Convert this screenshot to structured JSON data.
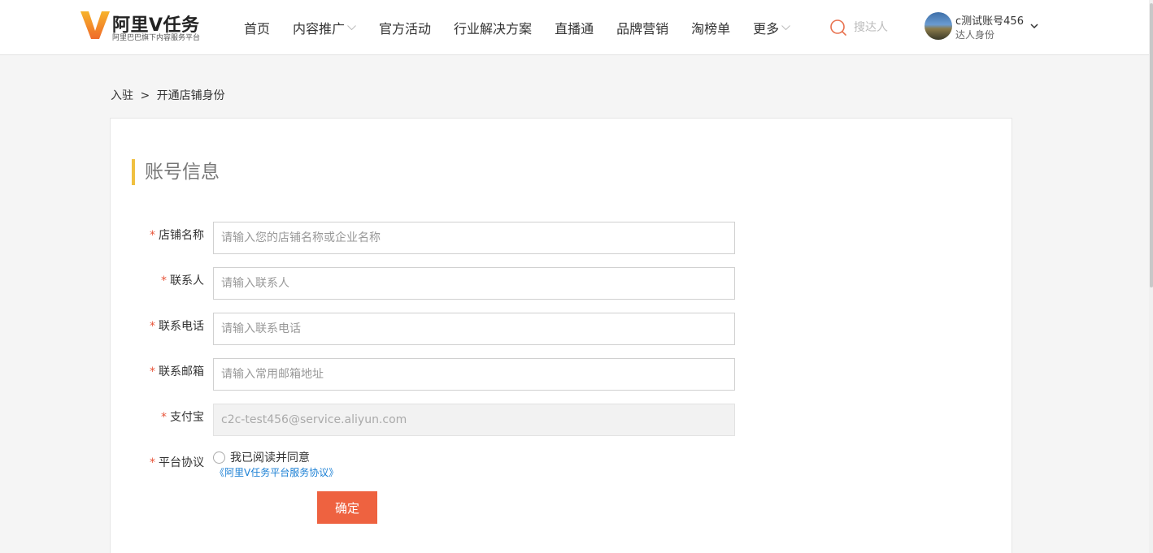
{
  "logo": {
    "mark": "V",
    "title": "阿里V任务",
    "subtitle": "阿里巴巴旗下内容服务平台"
  },
  "nav": {
    "items": [
      {
        "label": "首页",
        "dropdown": false
      },
      {
        "label": "内容推广",
        "dropdown": true
      },
      {
        "label": "官方活动",
        "dropdown": false
      },
      {
        "label": "行业解决方案",
        "dropdown": false
      },
      {
        "label": "直播通",
        "dropdown": false
      },
      {
        "label": "品牌营销",
        "dropdown": false
      },
      {
        "label": "淘榜单",
        "dropdown": false
      },
      {
        "label": "更多",
        "dropdown": true
      }
    ]
  },
  "search": {
    "placeholder": "搜达人"
  },
  "user": {
    "name": "c测试账号456",
    "role": "达人身份"
  },
  "breadcrumb": {
    "parent": "入驻",
    "separator": ">",
    "current": "开通店铺身份"
  },
  "form": {
    "section_title": "账号信息",
    "required_mark": "*",
    "fields": [
      {
        "label": "店铺名称",
        "placeholder": "请输入您的店铺名称或企业名称",
        "value": ""
      },
      {
        "label": "联系人",
        "placeholder": "请输入联系人",
        "value": ""
      },
      {
        "label": "联系电话",
        "placeholder": "请输入联系电话",
        "value": ""
      },
      {
        "label": "联系邮箱",
        "placeholder": "请输入常用邮箱地址",
        "value": ""
      },
      {
        "label": "支付宝",
        "placeholder": "",
        "value": "c2c-test456@service.aliyun.com"
      }
    ],
    "agreement": {
      "label": "平台协议",
      "checkbox_text": "我已阅读并同意",
      "link_text": "《阿里V任务平台服务协议》",
      "checked": false
    },
    "submit_label": "确定"
  },
  "colors": {
    "accent": "#ee6240",
    "title_bar": "#f0c040",
    "link": "#1a7fd4",
    "required": "#e8553a"
  }
}
